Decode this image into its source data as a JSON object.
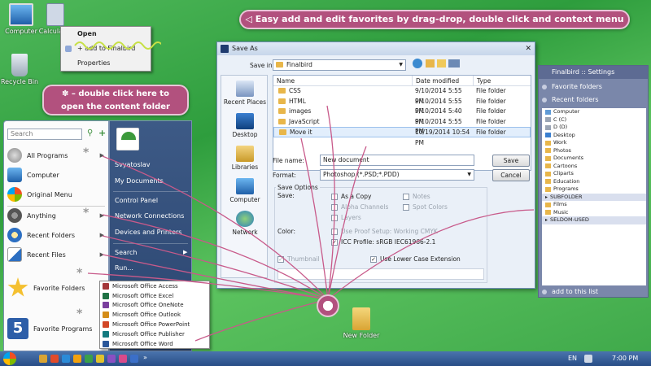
{
  "desktop": {
    "icons": [
      {
        "label": "Computer",
        "icon": "computer-icon"
      },
      {
        "label": "Calculator",
        "icon": "calculator-icon"
      },
      {
        "label": "Recycle Bin",
        "icon": "recycle-bin-icon"
      },
      {
        "label": "New Folder",
        "icon": "folder-icon"
      }
    ]
  },
  "callouts": {
    "top": "Easy add and edit favorites by drag-drop, double click and context menu",
    "left_line1": "– double click here to",
    "left_line2": "open the content folder"
  },
  "context_menu": {
    "items": [
      "Open",
      "+ add to Finalbird",
      "Properties"
    ]
  },
  "start_menu": {
    "search_placeholder": "Search",
    "left_items": [
      "All Programs",
      "Computer",
      "Original Menu",
      "Anything",
      "Recent Folders",
      "Recent Files",
      "Favorite Folders",
      "Favorite Programs"
    ],
    "right_items": [
      "Svyatoslav",
      "My Documents",
      "Control Panel",
      "Network Connections",
      "Devices and Printers",
      "Search",
      "Run..."
    ]
  },
  "office_menu": {
    "items": [
      "Microsoft Office Access",
      "Microsoft Office Excel",
      "Microsoft Office OneNote",
      "Microsoft Office Outlook",
      "Microsoft Office PowerPoint",
      "Microsoft Office Publisher",
      "Microsoft Office Word"
    ]
  },
  "save_dialog": {
    "title": "Save As",
    "save_in_label": "Save in:",
    "save_in_value": "Finalbird",
    "places": [
      "Recent Places",
      "Desktop",
      "Libraries",
      "Computer",
      "Network"
    ],
    "columns": [
      "Name",
      "Date modified",
      "Type"
    ],
    "rows": [
      {
        "name": "CSS",
        "date": "9/10/2014 5:55 PM",
        "type": "File folder"
      },
      {
        "name": "HTML",
        "date": "9/10/2014 5:55 PM",
        "type": "File folder"
      },
      {
        "name": "images",
        "date": "9/10/2014 5:40 PM",
        "type": "File folder"
      },
      {
        "name": "JavaScript",
        "date": "9/10/2014 5:55 PM",
        "type": "File folder"
      },
      {
        "name": "Move it",
        "date": "10/19/2014 10:54 PM",
        "type": "File folder"
      }
    ],
    "file_name_label": "File name:",
    "file_name_value": "New document",
    "format_label": "Format:",
    "format_value": "Photoshop (*.PSD;*.PDD)",
    "save_button": "Save",
    "cancel_button": "Cancel",
    "save_options_label": "Save Options",
    "save_label": "Save:",
    "opt_as_copy": "As a Copy",
    "opt_notes": "Notes",
    "opt_alpha": "Alpha Channels",
    "opt_spot": "Spot Colors",
    "opt_layers": "Layers",
    "color_label": "Color:",
    "opt_proof": "Use Proof Setup:  Working CMYK",
    "opt_icc": "ICC Profile:  sRGB IEC61966-2.1",
    "opt_thumbnail": "Thumbnail",
    "opt_lowercase": "Use Lower Case Extension"
  },
  "finalbird": {
    "title": "Finalbird  ::  Settings",
    "favorite_folders": "Favorite folders",
    "recent_folders": "Recent folders",
    "tree": [
      "Computer",
      "C (C)",
      "D (D)",
      "Desktop",
      "Work",
      "Photos",
      "Documents",
      "Cartoons",
      "Cliparts",
      "Education",
      "Programs",
      "SUBFOLDER",
      "Films",
      "Music",
      "SELDOM-USED"
    ],
    "add_to_list": "add to this list"
  },
  "taskbar": {
    "language": "EN",
    "time": "7:00 PM"
  },
  "colors": {
    "callout": "#b2517e",
    "start_right": "#2b4570",
    "panel": "#7a87aa",
    "taskbar": "#284d86"
  }
}
